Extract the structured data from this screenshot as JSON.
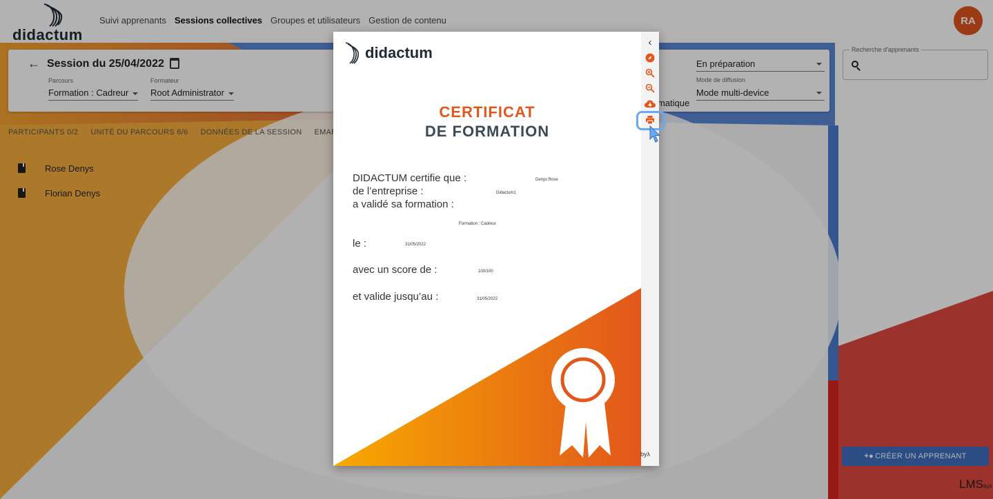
{
  "app": {
    "logo_text": "didactum",
    "nav": [
      "Suivi apprenants",
      "Sessions collectives",
      "Groupes et utilisateurs",
      "Gestion de contenu"
    ],
    "active_nav": "Sessions collectives",
    "avatar_initials": "RA"
  },
  "session": {
    "title": "Session du 25/04/2022",
    "parcours_label": "Parcours",
    "parcours_value": "Formation : Cadreur",
    "formateur_label": "Formateur",
    "formateur_value": "Root Administrator",
    "status_value": "En préparation",
    "diffusion_label": "Mode de diffusion",
    "diffusion_value": "Mode multi-device",
    "partial_label": "matique"
  },
  "tabs": [
    "PARTICIPANTS 0/2",
    "UNITÉ DU PARCOURS 6/6",
    "DONNÉES DE LA SESSION",
    "EMARG"
  ],
  "participants": [
    "Rose Denys",
    "Florian Denys"
  ],
  "search": {
    "label": "Recherche d'apprenants"
  },
  "create_button": "CRÉER UN APPRENANT",
  "footer": {
    "lms": "LMS",
    "lms_by": "byλ",
    "viewer_by": "byλ"
  },
  "certificate": {
    "logo_text": "didactum",
    "title_line1": "CERTIFICAT",
    "title_line2": "DE FORMATION",
    "line_certifie": "DIDACTUM certifie que :",
    "value_name": "Denys Rose",
    "line_entreprise": "de l’entreprise :",
    "value_entreprise": "Didactum1",
    "line_valide": "a validé sa formation :",
    "value_formation": "Formation : Cadreur",
    "line_le": "le :",
    "value_date": "31/05/2022",
    "line_score": "avec un score de :",
    "value_score": "100/100",
    "line_valide_jusqu": "et valide jusqu’au :",
    "value_valid_date": "31/05/2022"
  },
  "toolbar": {
    "icons": [
      "chevron-left-icon",
      "compass-icon",
      "zoom-in-icon",
      "zoom-out-icon",
      "download-icon",
      "print-icon"
    ]
  },
  "colors": {
    "accent": "#e2571c",
    "blue": "#3f6dbf",
    "dark": "#1f2a36"
  }
}
